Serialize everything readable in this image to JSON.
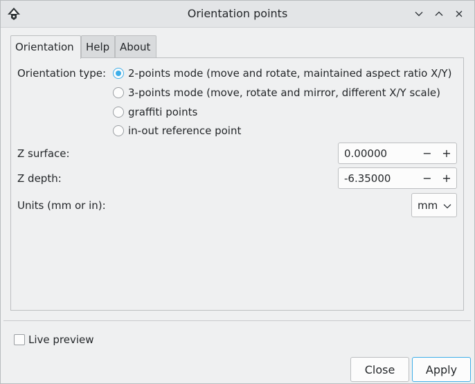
{
  "window": {
    "title": "Orientation points",
    "controls": {
      "minimize_icon": "chevron-down-icon",
      "maximize_icon": "chevron-up-icon",
      "close_icon": "close-icon"
    }
  },
  "tabs": [
    {
      "label": "Orientation",
      "active": true
    },
    {
      "label": "Help",
      "active": false
    },
    {
      "label": "About",
      "active": false
    }
  ],
  "orientation": {
    "type_label": "Orientation type:",
    "options": [
      {
        "label": "2-points mode (move and rotate, maintained aspect ratio X/Y)",
        "checked": true
      },
      {
        "label": "3-points mode (move, rotate and mirror, different X/Y scale)",
        "checked": false
      },
      {
        "label": "graffiti points",
        "checked": false
      },
      {
        "label": "in-out reference point",
        "checked": false
      }
    ],
    "z_surface": {
      "label": "Z surface:",
      "value": "0.00000",
      "minus": "−",
      "plus": "+"
    },
    "z_depth": {
      "label": "Z depth:",
      "value": "-6.35000",
      "minus": "−",
      "plus": "+"
    },
    "units": {
      "label": "Units (mm or in):",
      "value": "mm"
    }
  },
  "footer": {
    "live_preview": {
      "label": "Live preview",
      "checked": false
    },
    "close_label": "Close",
    "apply_label": "Apply"
  },
  "colors": {
    "accent": "#3daee9",
    "background": "#eff0f1"
  }
}
